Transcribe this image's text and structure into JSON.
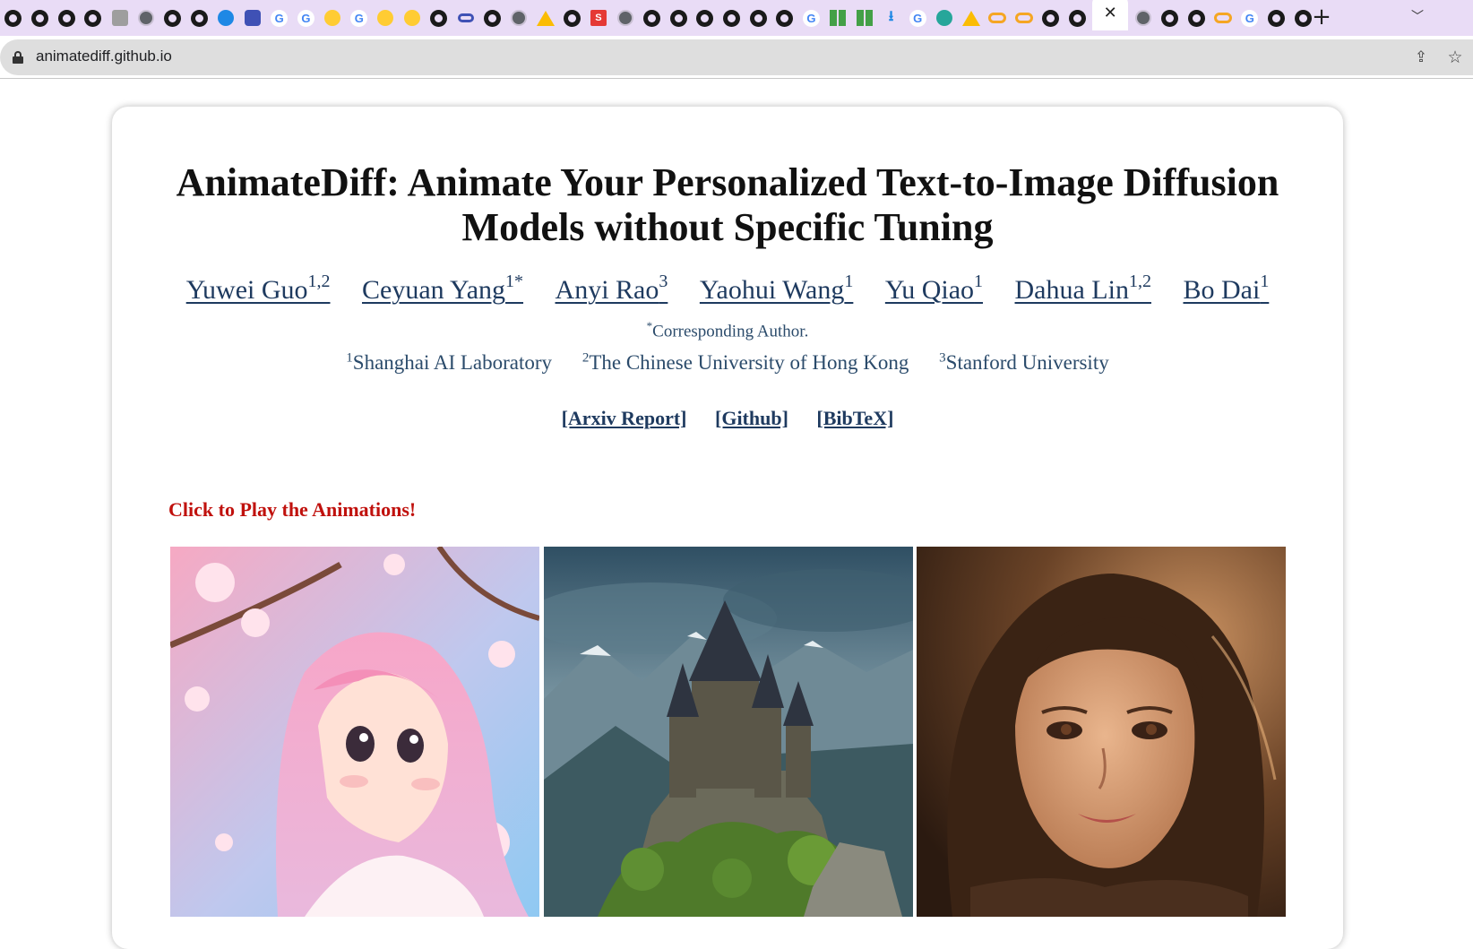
{
  "browser": {
    "url": "animatediff.github.io",
    "new_tab_symbol": "+",
    "close_tab_symbol": "✕",
    "tab_list_symbol": "﹀",
    "tab_favicons": [
      "github-icon",
      "github-icon",
      "github-icon",
      "github-icon",
      "misc-icon",
      "globe-icon",
      "github-icon",
      "github-icon",
      "blue-circle-icon",
      "shield-icon",
      "google-icon",
      "google-icon",
      "emoji-icon",
      "google-icon",
      "emoji-icon",
      "emoji-icon",
      "github-icon",
      "link-icon",
      "github-icon",
      "globe-icon",
      "drive-icon",
      "github-icon",
      "red-s-icon",
      "globe-icon",
      "github-icon",
      "github-icon",
      "github-icon",
      "github-icon",
      "github-icon",
      "github-icon",
      "google-icon",
      "grid-icon",
      "grid-icon",
      "download-icon",
      "google-icon",
      "gear-icon",
      "drive-icon",
      "infinity-icon",
      "infinity-icon",
      "github-icon",
      "github-icon"
    ],
    "tab_favicons_after_active": [
      "globe-icon",
      "github-icon",
      "github-icon",
      "infinity-icon",
      "google-icon",
      "github-icon",
      "github-icon"
    ]
  },
  "page": {
    "title": "AnimateDiff: Animate Your Personalized Text-to-Image Diffusion Models without Specific Tuning",
    "authors": [
      {
        "name": "Yuwei Guo",
        "sup": "1,2"
      },
      {
        "name": "Ceyuan Yang",
        "sup": "1*"
      },
      {
        "name": "Anyi Rao",
        "sup": "3"
      },
      {
        "name": "Yaohui Wang",
        "sup": "1"
      },
      {
        "name": "Yu Qiao",
        "sup": "1"
      },
      {
        "name": "Dahua Lin",
        "sup": "1,2"
      },
      {
        "name": "Bo Dai",
        "sup": "1"
      }
    ],
    "corresponding": {
      "mark": "*",
      "text": "Corresponding Author."
    },
    "affiliations": [
      {
        "sup": "1",
        "name": "Shanghai AI Laboratory"
      },
      {
        "sup": "2",
        "name": "The Chinese University of Hong Kong"
      },
      {
        "sup": "3",
        "name": "Stanford University"
      }
    ],
    "links": [
      "[Arxiv Report]",
      "[Github]",
      "[BibTeX]"
    ],
    "cta": "Click to Play the Animations!",
    "gallery": [
      {
        "subject": "anime-girl-cherry-blossoms",
        "palette": [
          "#f3a7c1",
          "#9fd0f2",
          "#ffd9e6"
        ]
      },
      {
        "subject": "castle-on-cliff",
        "palette": [
          "#3a5d73",
          "#6f8fa0",
          "#4d6e2f"
        ]
      },
      {
        "subject": "portrait-woman-warm-light",
        "palette": [
          "#5a3621",
          "#c78b5f",
          "#e8b083"
        ]
      }
    ]
  }
}
